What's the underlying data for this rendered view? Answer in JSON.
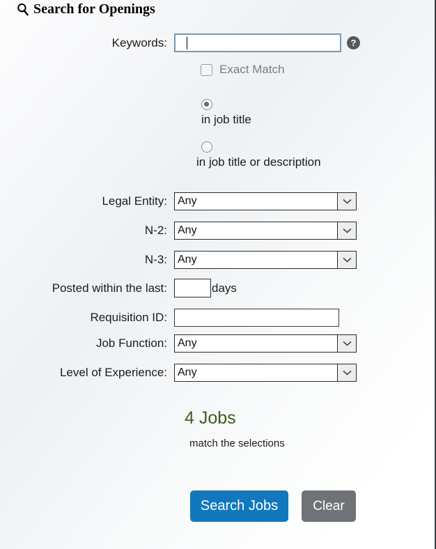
{
  "panel": {
    "title": "Search for Openings",
    "search_icon": "search-icon"
  },
  "keywords": {
    "label": "Keywords:",
    "value": "",
    "placeholder": "",
    "help_icon": "?",
    "help_icon_name": "help-question-icon"
  },
  "exact_match": {
    "label": "Exact Match",
    "checked": false,
    "disabled": true
  },
  "scope_radios": {
    "selected": "in job title",
    "options": [
      {
        "label": "in job title",
        "checked": true
      },
      {
        "label": "in job title or description",
        "checked": false
      }
    ]
  },
  "filters": [
    {
      "label": "Legal Entity:",
      "value": "Any",
      "type": "select"
    },
    {
      "label": "N-2:",
      "value": "Any",
      "type": "select"
    },
    {
      "label": "N-3:",
      "value": "Any",
      "type": "select"
    }
  ],
  "posted_within": {
    "label": "Posted within the last:",
    "value": "",
    "unit": "days"
  },
  "requisition": {
    "label": "Requisition ID:",
    "value": "",
    "placeholder": ""
  },
  "filters2": [
    {
      "label": "Job Function:",
      "value": "Any",
      "type": "select"
    },
    {
      "label": "Level of Experience:",
      "value": "Any",
      "type": "select"
    }
  ],
  "results": {
    "count_text": "4 Jobs",
    "match_text": "match the selections",
    "count_color": "#3d5c1c"
  },
  "buttons": {
    "search": "Search Jobs",
    "clear": "Clear",
    "search_color": "#1278be",
    "clear_color": "#6f7276"
  }
}
